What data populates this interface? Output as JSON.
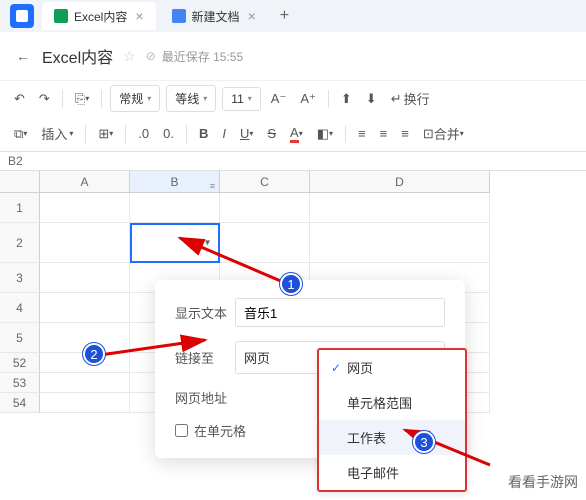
{
  "tabs": [
    {
      "label": "Excel内容",
      "type": "sheet"
    },
    {
      "label": "新建文档",
      "type": "doc"
    }
  ],
  "title": {
    "back": "←",
    "name": "Excel内容",
    "star": "☆",
    "cloud": "⊘",
    "saved": "最近保存 15:55"
  },
  "toolbar": {
    "undo": "↶",
    "redo": "↷",
    "paint": "🖌",
    "format": "常规",
    "border_style": "等线",
    "font_size": "11",
    "bold": "B",
    "italic": "I",
    "underline": "U",
    "strike": "S",
    "color_a": "A",
    "fill": "🎨",
    "align_top": "↑",
    "align_mid": "↓",
    "wrap": "换行",
    "insert": "插入",
    "decimal_inc": ".0",
    "decimal_dec": "0.",
    "merge": "合并"
  },
  "cell_ref": "B2",
  "cols": [
    "A",
    "B",
    "C",
    "D"
  ],
  "visible_rows": [
    "1",
    "2",
    "3",
    "4",
    "5",
    "52",
    "53",
    "54"
  ],
  "popup": {
    "display_label": "显示文本",
    "display_value": "音乐1",
    "link_label": "链接至",
    "link_value": "网页",
    "url_label": "网页地址",
    "checkbox_label": "在单元格"
  },
  "dropdown": {
    "items": [
      "网页",
      "单元格范围",
      "工作表",
      "电子邮件"
    ],
    "selected": "网页",
    "highlight": "工作表"
  },
  "annot": {
    "n1": "1",
    "n2": "2",
    "n3": "3"
  },
  "watermark": "看看手游网"
}
